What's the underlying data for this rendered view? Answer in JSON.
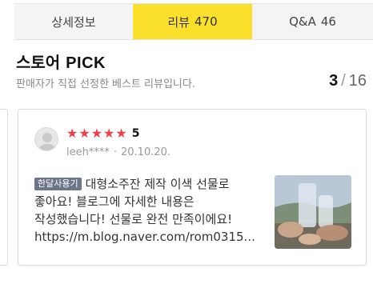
{
  "tabs": [
    {
      "label": "상세정보",
      "count": ""
    },
    {
      "label": "리뷰",
      "count": "470"
    },
    {
      "label": "Q&A",
      "count": "46"
    }
  ],
  "store_pick": {
    "title_ko": "스토어",
    "title_en": "PICK",
    "subtitle": "판매자가 직접 선정한 베스트 리뷰입니다.",
    "current": "3",
    "separator": "/",
    "total": "16"
  },
  "review": {
    "rating": "5",
    "stars": 5,
    "user": "leeh****",
    "date": "20.10.20.",
    "badge": "한달사용기",
    "lines": [
      "대형소주잔 제작 이색 선물로",
      "좋아요! 블로그에 자세한 내용은",
      "작성했습니다! 선물로 완전 만족이에요!"
    ],
    "url": "https://m.blog.naver.com/rom0315..."
  },
  "colors": {
    "active_tab": "#fbe02b",
    "star": "#f0404b",
    "badge": "#6b7789"
  },
  "icons": {
    "avatar": "avatar-placeholder-icon",
    "star": "star-icon"
  }
}
